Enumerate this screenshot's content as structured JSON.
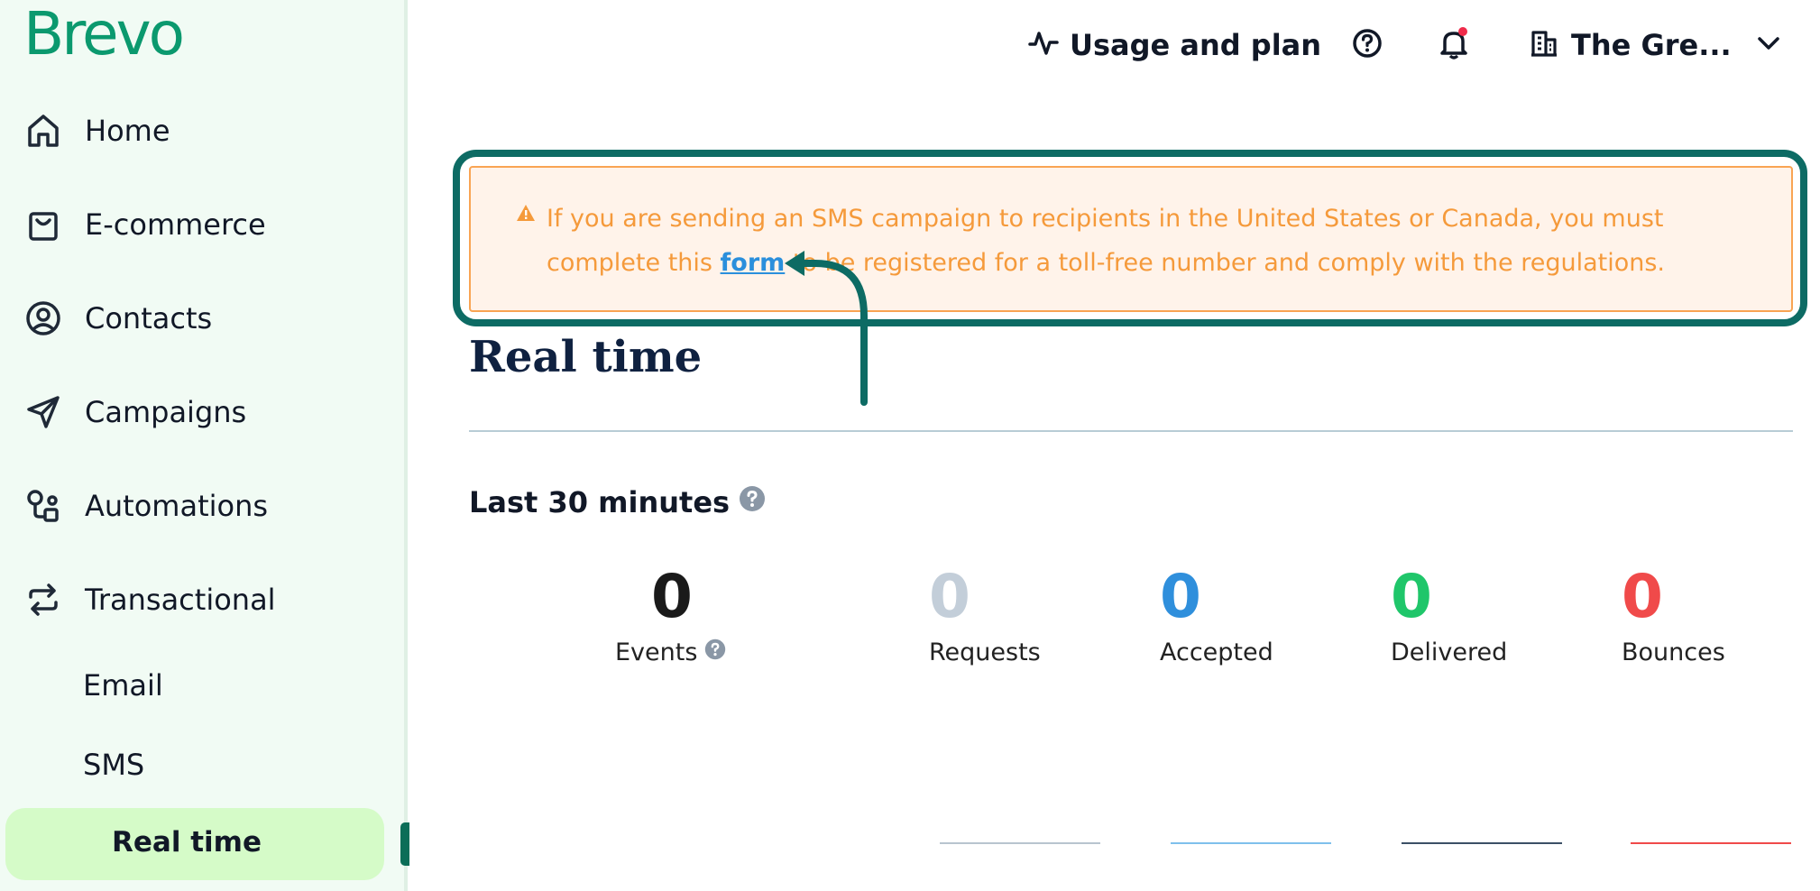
{
  "brand": {
    "name": "Brevo",
    "color": "#0b996e"
  },
  "sidebar": {
    "items": [
      {
        "label": "Home",
        "icon": "home-icon"
      },
      {
        "label": "E-commerce",
        "icon": "shopping-bag-icon"
      },
      {
        "label": "Contacts",
        "icon": "user-circle-icon"
      },
      {
        "label": "Campaigns",
        "icon": "send-icon"
      },
      {
        "label": "Automations",
        "icon": "automation-icon"
      },
      {
        "label": "Transactional",
        "icon": "repeat-icon"
      }
    ],
    "subitems": [
      {
        "label": "Email"
      },
      {
        "label": "SMS"
      },
      {
        "label": "Real time"
      }
    ],
    "active": "Real time"
  },
  "topbar": {
    "usage_label": "Usage and plan",
    "account_label": "The Gre..."
  },
  "alert": {
    "text_before": "If you are sending an SMS campaign to recipients in the United States or Canada, you must complete this ",
    "link_text": "form",
    "text_after": " to be registered for a toll-free number and comply with the regulations."
  },
  "page": {
    "title": "Real time",
    "section_title": "Last 30 minutes"
  },
  "stats": [
    {
      "value": "0",
      "label": "Events",
      "color": "#1a1a1a"
    },
    {
      "value": "0",
      "label": "Requests",
      "color": "#c3ced9"
    },
    {
      "value": "0",
      "label": "Accepted",
      "color": "#2f8fdc"
    },
    {
      "value": "0",
      "label": "Delivered",
      "color": "#1fc66a"
    },
    {
      "value": "0",
      "label": "Bounces",
      "color": "#f04a4a"
    }
  ]
}
